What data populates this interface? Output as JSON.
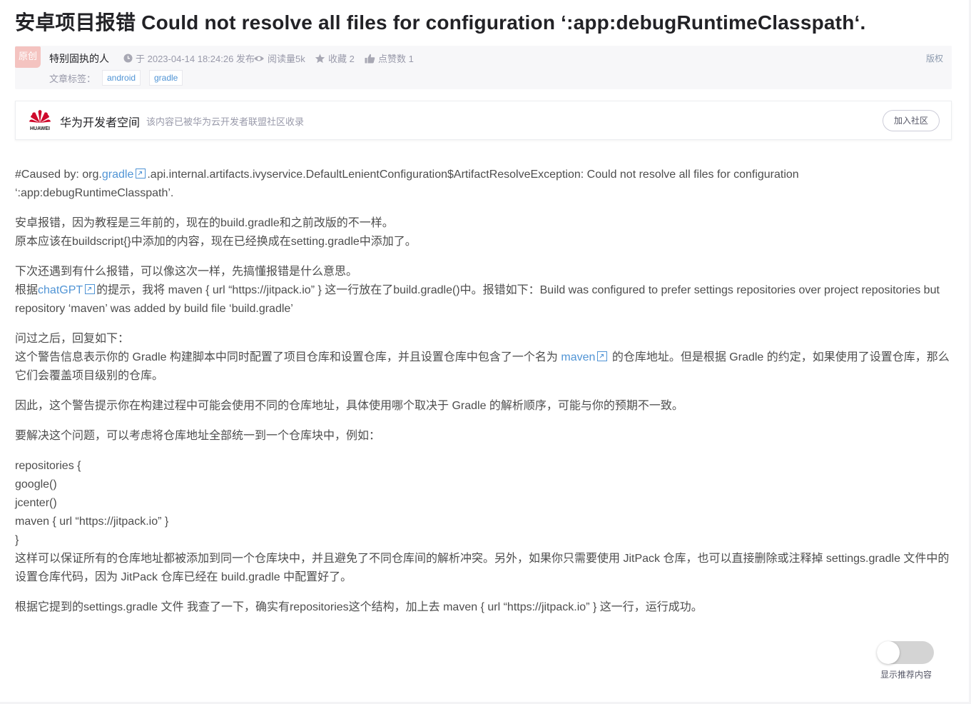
{
  "article": {
    "title": "安卓项目报错 Could not resolve all files for configuration ‘:app:debugRuntimeClasspath‘.",
    "meta": {
      "badge": "原创",
      "author": "特别固执的人",
      "published": "于 2023-04-14 18:24:26 发布",
      "reads": "阅读量5k",
      "favorites": "收藏 2",
      "likes": "点赞数 1",
      "copyright": "版权",
      "tags_label": "文章标签：",
      "tags": [
        "android",
        "gradle"
      ]
    },
    "community": {
      "logo_text": "HUAWEI",
      "name": "华为开发者空间",
      "desc": "该内容已被华为云开发者联盟社区收录",
      "join": "加入社区"
    },
    "body": {
      "p1_a": "#Caused by: org.",
      "p1_link": "gradle",
      "p1_b": ".api.internal.artifacts.ivyservice.DefaultLenientConfiguration$ArtifactResolveException: Could not resolve all files for configuration ‘:app:debugRuntimeClasspath’.",
      "p2_l1": "安卓报错，因为教程是三年前的，现在的build.gradle和之前改版的不一样。",
      "p2_l2": "原本应该在buildscript{}中添加的内容，现在已经换成在setting.gradle中添加了。",
      "p3_l1": "下次还遇到有什么报错，可以像这次一样，先搞懂报错是什么意思。",
      "p3_a": "根据",
      "p3_link": "chatGPT",
      "p3_b": "的提示，我将 maven { url “https://jitpack.io” } 这一行放在了build.gradle()中。报错如下：Build was configured to prefer settings repositories over project repositories but repository ‘maven’ was added by build file ‘build.gradle’",
      "p4_l1": "问过之后，回复如下：",
      "p4_a": "这个警告信息表示你的 Gradle 构建脚本中同时配置了项目仓库和设置仓库，并且设置仓库中包含了一个名为 ",
      "p4_link": "maven",
      "p4_b": " 的仓库地址。但是根据 Gradle 的约定，如果使用了设置仓库，那么它们会覆盖项目级别的仓库。",
      "p5": "因此，这个警告提示你在构建过程中可能会使用不同的仓库地址，具体使用哪个取决于 Gradle 的解析顺序，可能与你的预期不一致。",
      "p6": "要解决这个问题，可以考虑将仓库地址全部统一到一个仓库块中，例如：",
      "code": [
        "repositories {",
        "google()",
        "jcenter()",
        "maven { url “https://jitpack.io” }",
        "}"
      ],
      "p7": "这样可以保证所有的仓库地址都被添加到同一个仓库块中，并且避免了不同仓库间的解析冲突。另外，如果你只需要使用 JitPack 仓库，也可以直接删除或注释掉 settings.gradle 文件中的设置仓库代码，因为 JitPack 仓库已经在 build.gradle 中配置好了。",
      "p8": "根据它提到的settings.gradle 文件 我查了一下，确实有repositories这个结构，加上去 maven { url “https://jitpack.io” } 这一行，运行成功。"
    }
  },
  "toggle": {
    "label": "显示推荐内容",
    "on": false
  },
  "colors": {
    "link": "#5094d5",
    "badge": "#f4c3c0",
    "meta_bg": "#f7f7f9",
    "huawei_red": "#cf0a2c"
  }
}
